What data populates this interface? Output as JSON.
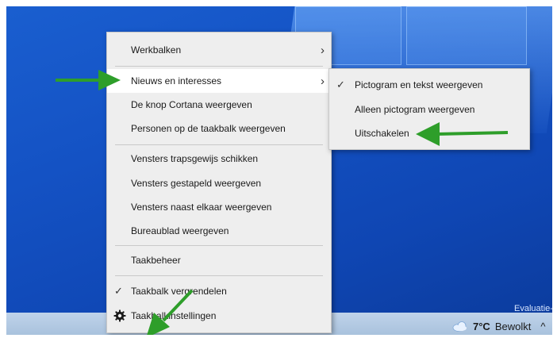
{
  "context_menu": {
    "items": [
      {
        "label": "Werkbalken",
        "has_submenu": true
      },
      {
        "label": "Nieuws en interesses",
        "has_submenu": true,
        "highlighted": true
      },
      {
        "label": "De knop Cortana weergeven"
      },
      {
        "label": "Personen op de taakbalk weergeven"
      },
      {
        "label": "Vensters trapsgewijs schikken"
      },
      {
        "label": "Vensters gestapeld weergeven"
      },
      {
        "label": "Vensters naast elkaar weergeven"
      },
      {
        "label": "Bureaublad weergeven"
      },
      {
        "label": "Taakbeheer"
      },
      {
        "label": "Taakbalk vergrendelen",
        "checked": true
      },
      {
        "label": "Taakbalkinstellingen",
        "icon": "gear-icon"
      }
    ]
  },
  "submenu": {
    "items": [
      {
        "label": "Pictogram en tekst weergeven",
        "checked": true
      },
      {
        "label": "Alleen pictogram weergeven"
      },
      {
        "label": "Uitschakelen"
      }
    ]
  },
  "taskbar": {
    "weather_temp": "7°C",
    "weather_desc": "Bewolkt",
    "weather_icon": "cloud-icon",
    "tray_caret": "^"
  },
  "watermark": "Evaluatie-e",
  "colors": {
    "annotation_arrow": "#2e9e2a",
    "menu_bg": "#eeeeee",
    "desktop_blue": "#1452c4"
  }
}
